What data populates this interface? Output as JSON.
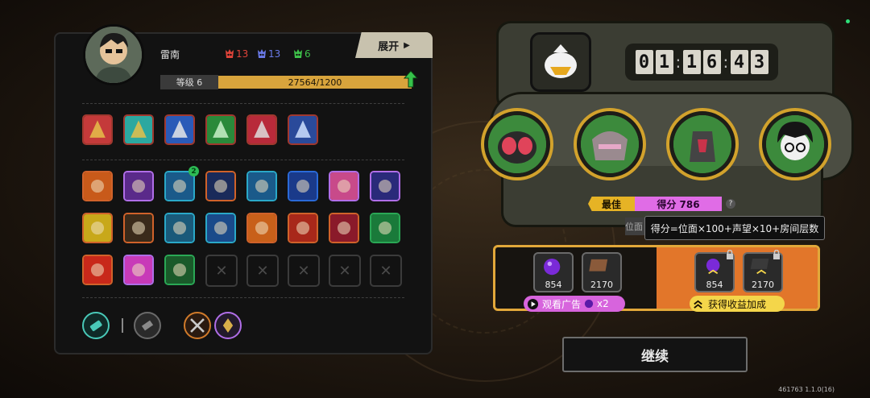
{
  "player": {
    "name": "雷南",
    "level_label": "等级 6",
    "xp_text": "27564/1200",
    "xp_fill_fraction": 1.0,
    "expand_label": "展开"
  },
  "resources": [
    {
      "value": "13",
      "color": "#e0443a",
      "icon": "red-mask-icon"
    },
    {
      "value": "13",
      "color": "#6a7ae8",
      "icon": "blue-mask-icon"
    },
    {
      "value": "6",
      "color": "#3ec24a",
      "icon": "green-mask-icon"
    }
  ],
  "skills_row1": [
    {
      "icon": "red-claw-skill-icon",
      "border": "#a0382e"
    },
    {
      "icon": "teal-slash-skill-icon",
      "border": "#a0382e"
    },
    {
      "icon": "blue-orb-skill-icon",
      "border": "#a0382e"
    },
    {
      "icon": "green-blade-skill-icon",
      "border": "#a0382e"
    },
    {
      "icon": "red-crest-skill-icon",
      "border": "#a0382e"
    },
    {
      "icon": "blue-figure-skill-icon",
      "border": "#a0382e"
    }
  ],
  "relics_badge": "2",
  "timer": {
    "d": [
      "0",
      "1",
      "1",
      "6",
      "4",
      "3"
    ]
  },
  "score": {
    "best_label": "最佳",
    "score_text": "得分 786",
    "tooltip": "得分=位面×100+声望×10+房间层数",
    "tip_lead": "位面"
  },
  "rewards": {
    "left_items": [
      {
        "value": "854",
        "icon": "purple-orb-icon"
      },
      {
        "value": "2170",
        "icon": "brown-card-icon"
      }
    ],
    "right_items": [
      {
        "value": "854",
        "icon": "purple-orb-icon"
      },
      {
        "value": "2170",
        "icon": "dark-card-icon"
      }
    ],
    "ad_label": "观看广告",
    "ad_multiplier": "x2",
    "bonus_label": "获得收益加成"
  },
  "continue_label": "继续",
  "version": "461763 1.1.0(16)"
}
